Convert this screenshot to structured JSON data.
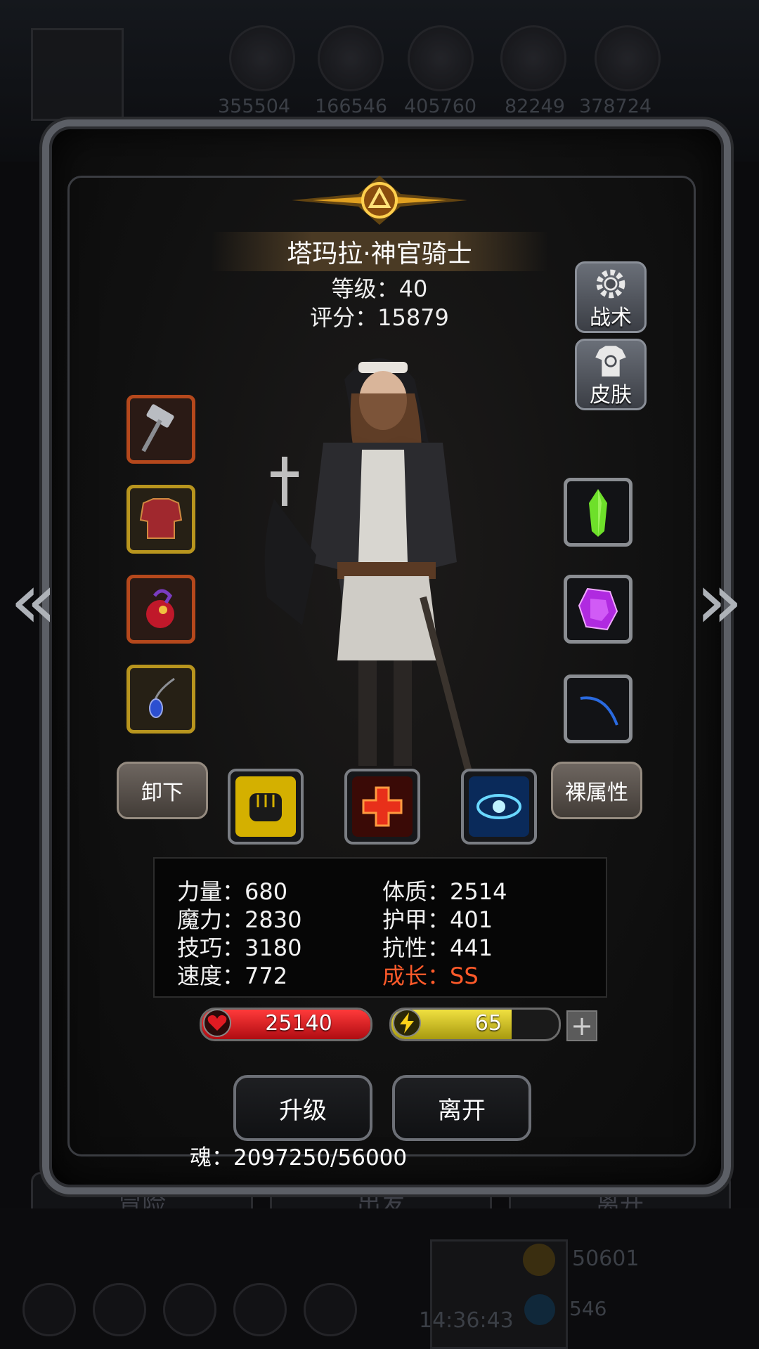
{
  "background": {
    "resources": [
      "355504",
      "166546",
      "405760",
      "82249",
      "378724"
    ],
    "nav_buttons": [
      "冒险",
      "出发",
      "离开"
    ],
    "gold": "50601",
    "gems": "546",
    "clock": "14:36:43"
  },
  "character": {
    "name": "塔玛拉·神官骑士",
    "level_label": "等级：40",
    "score_label": "评分：15879"
  },
  "side_buttons": {
    "tactics": "战术",
    "skin": "皮肤"
  },
  "equipment_left": [
    "hammer",
    "red-armor",
    "red-amulet-pouch",
    "blue-necklace"
  ],
  "equipment_right": [
    "green-crystal",
    "purple-gem",
    "blue-bow"
  ],
  "actions": {
    "unequip": "卸下",
    "bare_attributes": "裸属性"
  },
  "skills": [
    "fist",
    "heal-cross",
    "eye"
  ],
  "stats": {
    "left": [
      "力量：680",
      "魔力：2830",
      "技巧：3180",
      "速度：772"
    ],
    "right": [
      "体质：2514",
      "护甲：401",
      "抗性：441"
    ],
    "growth": "成长：SS"
  },
  "bars": {
    "hp": "25140",
    "energy": "65",
    "energy_fill": 0.72
  },
  "buttons": {
    "upgrade": "升级",
    "leave": "离开"
  },
  "soul": "魂：2097250/56000",
  "colors": {
    "hp": "#d4141a",
    "energy": "#d4c21a",
    "growth": "#ff5a2a"
  }
}
